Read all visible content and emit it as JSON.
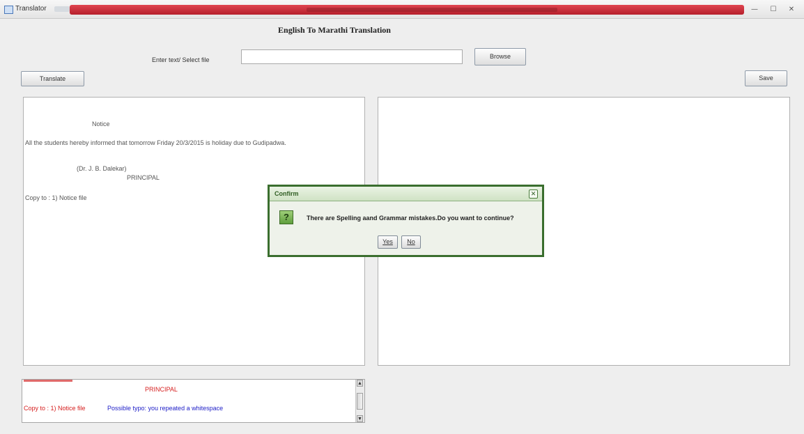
{
  "window": {
    "title": "Translator",
    "controls": {
      "minimize": "—",
      "maximize": "☐",
      "close": "✕"
    }
  },
  "header": {
    "title": "English To Marathi Translation"
  },
  "input_row": {
    "label": "Enter text/ Select file",
    "value": "",
    "browse_label": "Browse"
  },
  "toolbar": {
    "translate_label": "Translate",
    "save_label": "Save"
  },
  "source_panel": {
    "lines": [
      "Notice",
      "All the students hereby informed that tomorrow Friday 20/3/2015 is holiday due to Gudipadwa.",
      "(Dr. J. B. Dalekar)",
      "PRINCIPAL",
      "Copy to :  1) Notice file"
    ]
  },
  "output_panel": {
    "text": ""
  },
  "error_log": {
    "line1": "PRINCIPAL",
    "line2_red": "Copy to :  1) Notice file",
    "line2_blue": "Possible typo: you repeated a whitespace"
  },
  "dialog": {
    "title": "Confirm",
    "message": "There are Spelling aand Grammar mistakes.Do you want to continue?",
    "yes_label": "Yes",
    "no_label": "No",
    "icon": "question-icon",
    "accent_color": "#3a6e2e"
  },
  "colors": {
    "title_strip": "#c62a36",
    "error_text": "#d62020",
    "suggestion_text": "#2020c8"
  }
}
